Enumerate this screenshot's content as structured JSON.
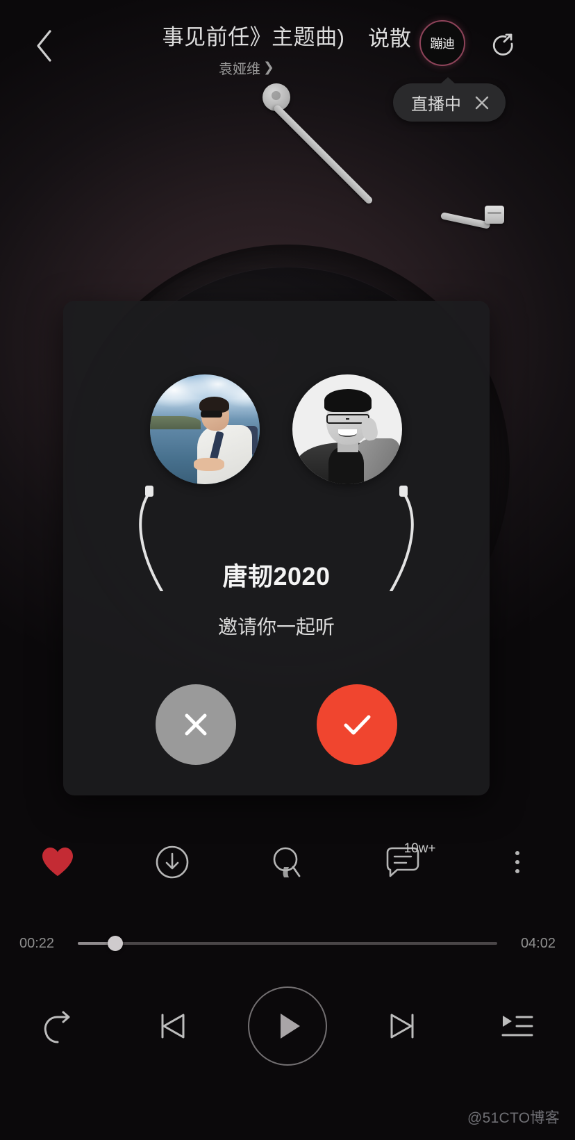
{
  "app": {
    "watermark": "@51CTO博客"
  },
  "header": {
    "back_icon": "chevron-left-icon",
    "song_title": "事见前任》主题曲)",
    "song_title_tail": "说散",
    "artist": "袁娅维",
    "artist_chevron": "chevron-right-icon",
    "live_badge_label": "蹦迪",
    "live_badge_border_color": "#8d4359",
    "share_icon": "share-arrow-icon",
    "live_tip": {
      "text": "直播中",
      "close_icon": "close-icon"
    }
  },
  "turntable": {
    "tonearm_icon": "tonearm",
    "disc_icon": "vinyl-disc"
  },
  "invite_modal": {
    "avatar_left_alt": "outdoor-photo-avatar",
    "avatar_right_alt": "portrait-photo-avatar",
    "cable_icon": "earphone-cable",
    "name": "唐韧2020",
    "subtitle": "邀请你一起听",
    "reject_icon": "close-icon",
    "accept_icon": "check-icon",
    "reject_color": "#9a9a9a",
    "accept_color": "#f0452f"
  },
  "actions": [
    {
      "name": "like-button",
      "icon": "heart-filled-icon",
      "color": "#c42b34",
      "badge": ""
    },
    {
      "name": "download-button",
      "icon": "download-icon",
      "color": "#b6b6b6",
      "badge": ""
    },
    {
      "name": "ringtone-button",
      "icon": "ringtone-icon",
      "color": "#b6b6b6",
      "badge": ""
    },
    {
      "name": "comment-button",
      "icon": "comment-icon",
      "color": "#b6b6b6",
      "badge": "10w+"
    },
    {
      "name": "more-button",
      "icon": "more-vertical-icon",
      "color": "#b6b6b6",
      "badge": ""
    }
  ],
  "progress": {
    "current_time": "00:22",
    "total_time": "04:02",
    "percent": 9
  },
  "player": [
    {
      "name": "repeat-mode-button",
      "icon": "repeat-icon"
    },
    {
      "name": "previous-button",
      "icon": "skip-previous-icon"
    },
    {
      "name": "play-button",
      "icon": "play-icon"
    },
    {
      "name": "next-button",
      "icon": "skip-next-icon"
    },
    {
      "name": "playlist-button",
      "icon": "playlist-icon"
    }
  ]
}
